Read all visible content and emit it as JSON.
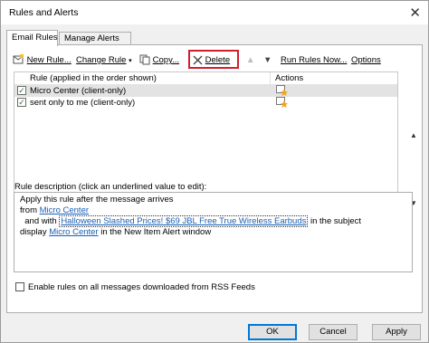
{
  "window": {
    "title": "Rules and Alerts",
    "close_glyph": "✕"
  },
  "tabs": [
    {
      "label": "Email Rules",
      "active": true
    },
    {
      "label": "Manage Alerts",
      "active": false
    }
  ],
  "toolbar": {
    "new_rule": "New Rule...",
    "change_rule": "Change Rule",
    "copy": "Copy...",
    "delete": "Delete",
    "run_rules_now": "Run Rules Now...",
    "options": "Options",
    "highlight_color": "#d0202c"
  },
  "rules_list": {
    "col_rule": "Rule (applied in the order shown)",
    "col_actions": "Actions",
    "rows": [
      {
        "name": "Micro Center  (client-only)",
        "checked": true,
        "selected": true
      },
      {
        "name": "sent only to me  (client-only)",
        "checked": true,
        "selected": false
      }
    ]
  },
  "description": {
    "label": "Rule description (click an underlined value to edit):",
    "line1": "Apply this rule after the message arrives",
    "line2_prefix": "from ",
    "line2_link": "Micro Center",
    "line3_prefix": "  and with ",
    "line3_link": "Halloween Slashed Prices! $69 JBL Free True Wireless Earbuds",
    "line3_suffix": " in the subject",
    "line4_prefix": "display ",
    "line4_link": "Micro Center",
    "line4_suffix": " in the New Item Alert window"
  },
  "rss_option": {
    "label": "Enable rules on all messages downloaded from RSS Feeds",
    "checked": false
  },
  "buttons": {
    "ok": "OK",
    "cancel": "Cancel",
    "apply": "Apply"
  }
}
